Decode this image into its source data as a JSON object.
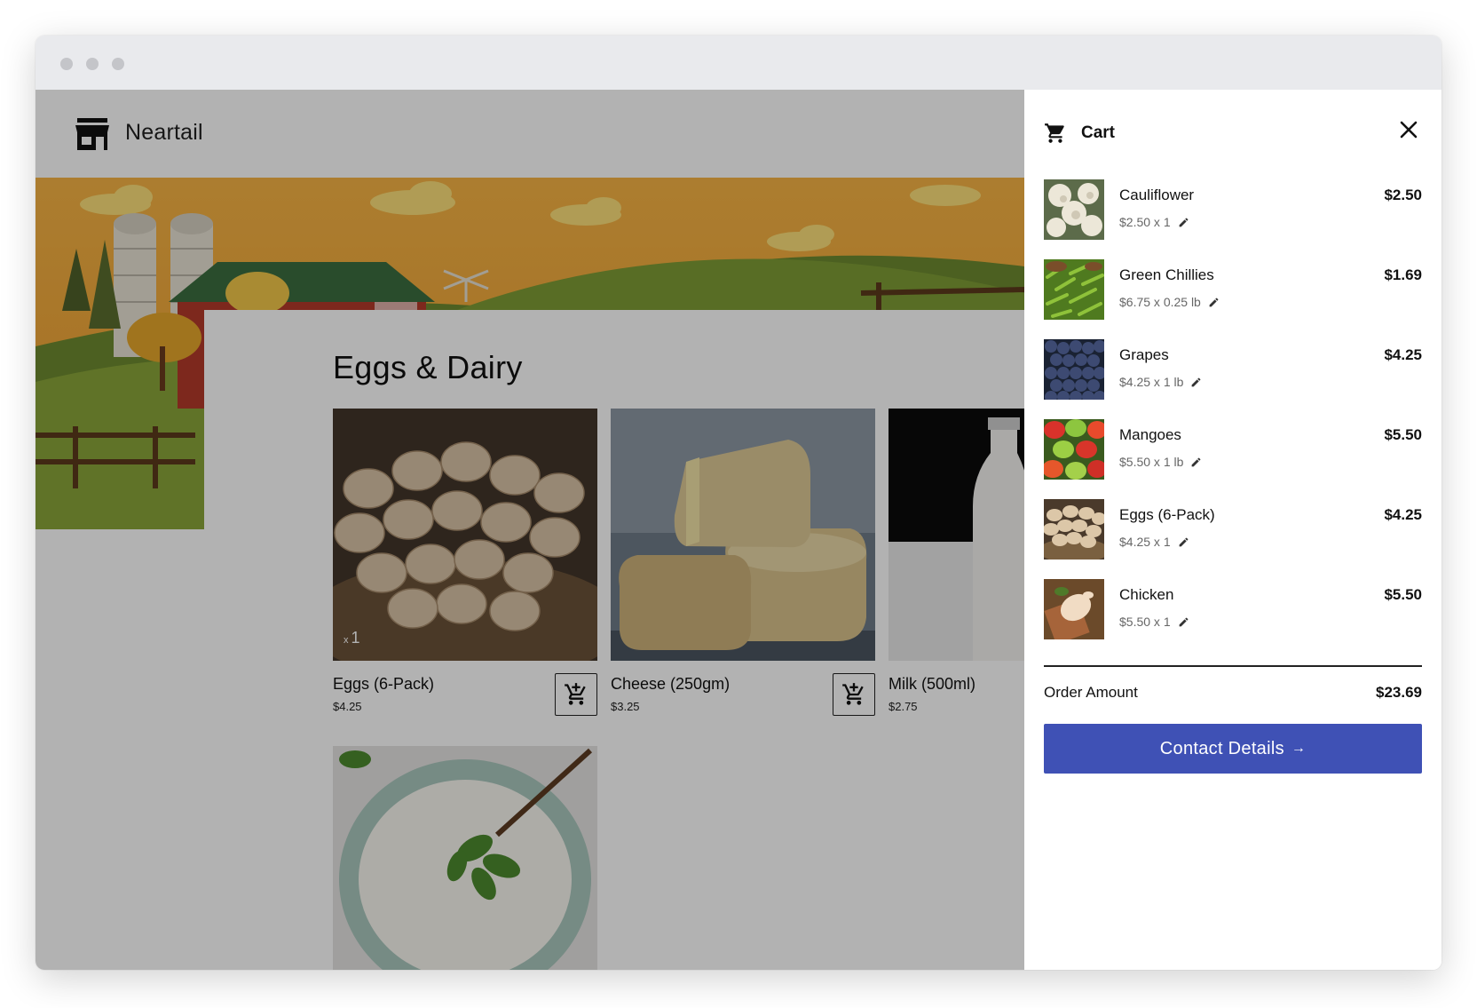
{
  "brand": {
    "name": "Neartail",
    "icon": "storefront-icon"
  },
  "section": {
    "title": "Eggs & Dairy"
  },
  "products": [
    {
      "name": "Eggs (6-Pack)",
      "price": "$4.25",
      "qty_prefix": "x",
      "qty": "1"
    },
    {
      "name": "Cheese (250gm)",
      "price": "$3.25"
    },
    {
      "name": "Milk (500ml)",
      "price": "$2.75"
    },
    {
      "name": "",
      "price": ""
    }
  ],
  "cart": {
    "title": "Cart",
    "items": [
      {
        "name": "Cauliflower",
        "detail": "$2.50 x 1",
        "total": "$2.50"
      },
      {
        "name": "Green Chillies",
        "detail": "$6.75 x 0.25 lb",
        "total": "$1.69"
      },
      {
        "name": "Grapes",
        "detail": "$4.25 x 1 lb",
        "total": "$4.25"
      },
      {
        "name": "Mangoes",
        "detail": "$5.50 x 1 lb",
        "total": "$5.50"
      },
      {
        "name": "Eggs (6-Pack)",
        "detail": "$4.25 x 1",
        "total": "$4.25"
      },
      {
        "name": "Chicken",
        "detail": "$5.50 x 1",
        "total": "$5.50"
      }
    ],
    "order_amount_label": "Order Amount",
    "order_amount": "$23.69",
    "contact_button": "Contact Details",
    "contact_arrow": "→"
  },
  "colors": {
    "accent": "#3f51b5",
    "overlay": "rgba(0,0,0,0.30)",
    "banner": "#f3a93a"
  }
}
